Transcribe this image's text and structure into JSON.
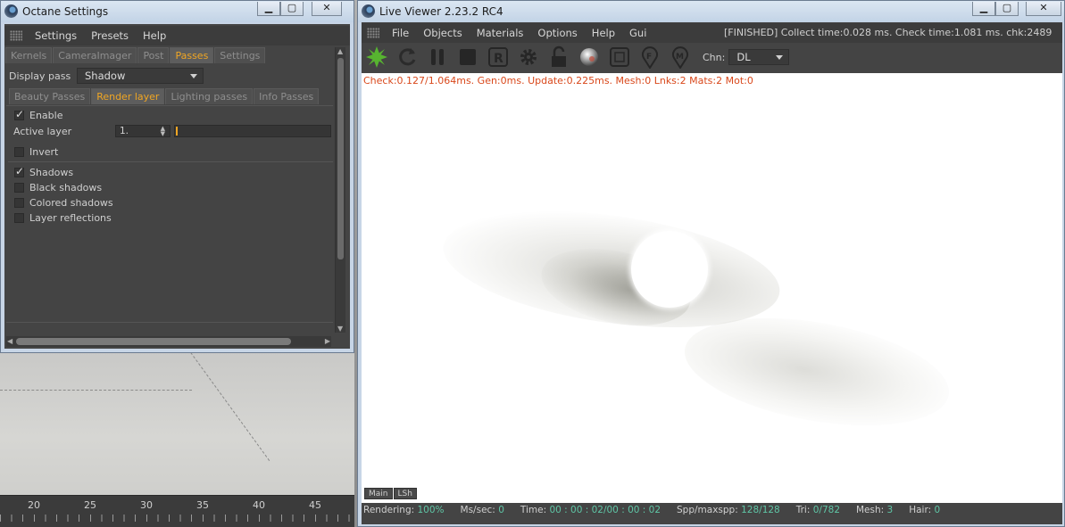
{
  "octane_settings": {
    "title": "Octane Settings",
    "menu": [
      "Settings",
      "Presets",
      "Help"
    ],
    "main_tabs": [
      {
        "label": "Kernels",
        "active": false
      },
      {
        "label": "CameraImager",
        "active": false
      },
      {
        "label": "Post",
        "active": false
      },
      {
        "label": "Passes",
        "active": true
      },
      {
        "label": "Settings",
        "active": false
      }
    ],
    "display_pass_label": "Display pass",
    "display_pass_value": "Shadow",
    "sub_tabs": [
      {
        "label": "Beauty Passes",
        "active": false
      },
      {
        "label": "Render layer",
        "active": true
      },
      {
        "label": "Lighting passes",
        "active": false
      },
      {
        "label": "Info Passes",
        "active": false
      }
    ],
    "enable_label": "Enable",
    "enable_checked": true,
    "active_layer_label": "Active layer",
    "active_layer_value": "1.",
    "active_layer_slider_fraction": 0,
    "invert_label": "Invert",
    "invert_checked": false,
    "options": [
      {
        "label": "Shadows",
        "checked": true
      },
      {
        "label": "Black shadows",
        "checked": false
      },
      {
        "label": "Colored shadows",
        "checked": false
      },
      {
        "label": "Layer reflections",
        "checked": false
      }
    ]
  },
  "timeline": {
    "labels": [
      "20",
      "25",
      "30",
      "35",
      "40",
      "45"
    ]
  },
  "live_viewer": {
    "title": "Live Viewer 2.23.2 RC4",
    "menu": [
      "File",
      "Objects",
      "Materials",
      "Options",
      "Help",
      "Gui"
    ],
    "header_status": "[FINISHED] Collect time:0.028 ms.  Check time:1.081 ms.  chk:2489",
    "toolbar_icons": [
      "octane-logo-icon",
      "refresh-icon",
      "pause-icon",
      "stop-icon",
      "region-render-icon",
      "settings-gear-icon",
      "lock-icon",
      "material-ball-icon",
      "viewport-icon",
      "focus-pin-icon",
      "material-pin-icon"
    ],
    "channel_label": "Chn:",
    "channel_value": "DL",
    "check_line": "Check:0.127/1.064ms. Gen:0ms. Update:0.225ms. Mesh:0 Lnks:2 Mats:2 Mot:0",
    "bottom_tabs": [
      "Main",
      "LSh"
    ],
    "status": {
      "rendering_label": "Rendering:",
      "rendering_value": "100%",
      "mssec_label": "Ms/sec:",
      "mssec_value": "0",
      "time_label": "Time:",
      "time_value": "00 : 00 : 02/00 : 00 : 02",
      "spp_label": "Spp/maxspp:",
      "spp_value": "128/128",
      "tri_label": "Tri:",
      "tri_value": "0/782",
      "mesh_label": "Mesh:",
      "mesh_value": "3",
      "hair_label": "Hair:",
      "hair_value": "0"
    },
    "colors": {
      "status_value": "#5fc6a6",
      "check_line": "#d9481b",
      "active_tab": "#f0a623"
    }
  }
}
